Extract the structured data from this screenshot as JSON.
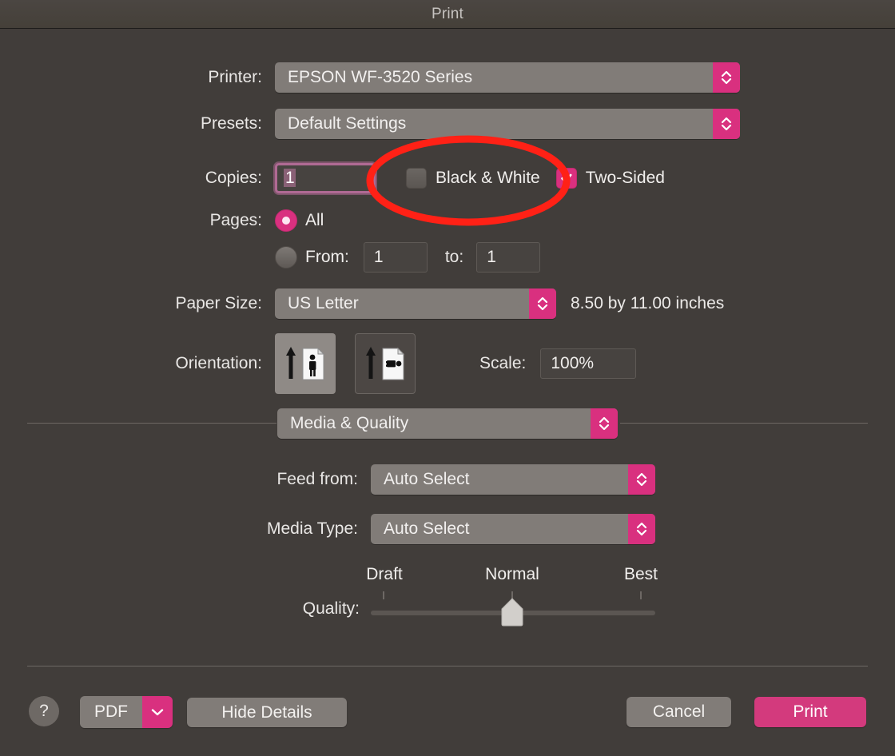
{
  "window": {
    "title": "Print"
  },
  "printer_row": {
    "label": "Printer:",
    "value": "EPSON WF-3520 Series"
  },
  "presets_row": {
    "label": "Presets:",
    "value": "Default Settings"
  },
  "copies_row": {
    "label": "Copies:",
    "value": "1",
    "black_white": {
      "label": "Black & White",
      "checked": "false"
    },
    "two_sided": {
      "label": "Two-Sided",
      "checked": "true",
      "check_glyph": "✓"
    }
  },
  "pages_row": {
    "label": "Pages:",
    "all_label": "All",
    "from_label": "From:",
    "from_value": "1",
    "to_label": "to:",
    "to_value": "1",
    "selected": "all"
  },
  "paper_size_row": {
    "label": "Paper Size:",
    "value": "US Letter",
    "dimensions": "8.50 by 11.00 inches"
  },
  "orientation_row": {
    "label": "Orientation:",
    "portrait_name": "portrait",
    "landscape_name": "landscape",
    "selected": "portrait"
  },
  "scale_row": {
    "label": "Scale:",
    "value": "100%"
  },
  "section_popup": {
    "value": "Media & Quality"
  },
  "feed_row": {
    "label": "Feed from:",
    "value": "Auto Select"
  },
  "media_type_row": {
    "label": "Media Type:",
    "value": "Auto Select"
  },
  "quality_row": {
    "label": "Quality:",
    "ticks": [
      "Draft",
      "Normal",
      "Best"
    ],
    "value": "Normal"
  },
  "footer": {
    "help_label": "?",
    "pdf_label": "PDF",
    "hide_details_label": "Hide Details",
    "cancel_label": "Cancel",
    "print_label": "Print"
  },
  "annotation": {
    "shape": "ellipse",
    "target": "Black & White",
    "color": "#FF2116"
  },
  "colors": {
    "background": "#413d3a",
    "control": "#817c78",
    "accent_pink": "#d9307f",
    "accent_pink_button": "#d33a7d",
    "text": "#f1efed",
    "annotation_red": "#FF2116",
    "focus_ring": "#b06a94"
  }
}
